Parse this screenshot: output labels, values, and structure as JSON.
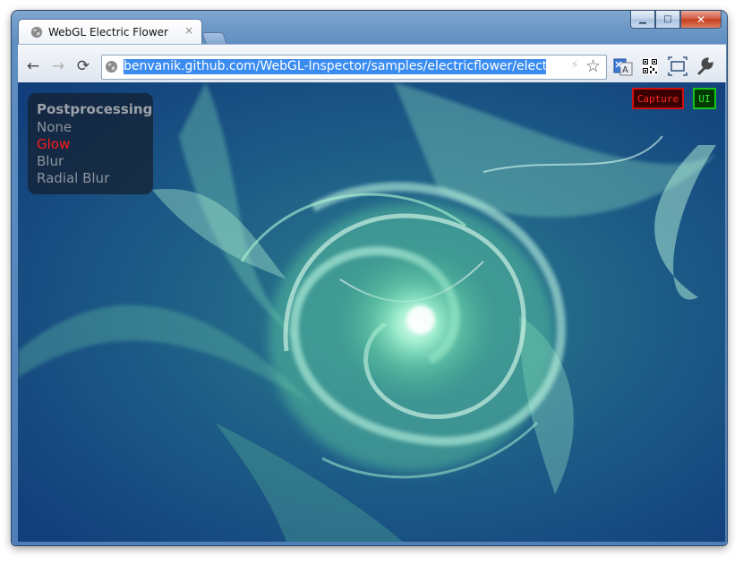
{
  "window": {
    "controls": {
      "minimize": "▁",
      "maximize": "□",
      "close": "✕"
    }
  },
  "tab": {
    "title": "WebGL Electric Flower",
    "close": "×",
    "favicon": "globe-icon"
  },
  "toolbar": {
    "back": "←",
    "forward": "→",
    "reload": "⟳",
    "address": "benvanik.github.com/WebGL-Inspector/samples/electricflower/electricflower.html",
    "address_visible": "benvanik.github.com/WebGL-Inspector/samples/electricflower/electricflow",
    "icons": [
      "globe-icon",
      "bolt-icon",
      "star-icon",
      "translate-icon",
      "qr-code-icon",
      "fullscreen-icon",
      "wrench-icon"
    ]
  },
  "page": {
    "menu": {
      "title": "Postprocessing",
      "items": [
        {
          "label": "None",
          "active": false
        },
        {
          "label": "Glow",
          "active": true
        },
        {
          "label": "Blur",
          "active": false
        },
        {
          "label": "Radial Blur",
          "active": false
        }
      ]
    },
    "capture_label": "Capture",
    "ui_label": "UI"
  },
  "colors": {
    "active_item": "#ff1b1b",
    "capture": "#ff2525",
    "ui": "#32f032",
    "selection": "#3a8cf0"
  }
}
